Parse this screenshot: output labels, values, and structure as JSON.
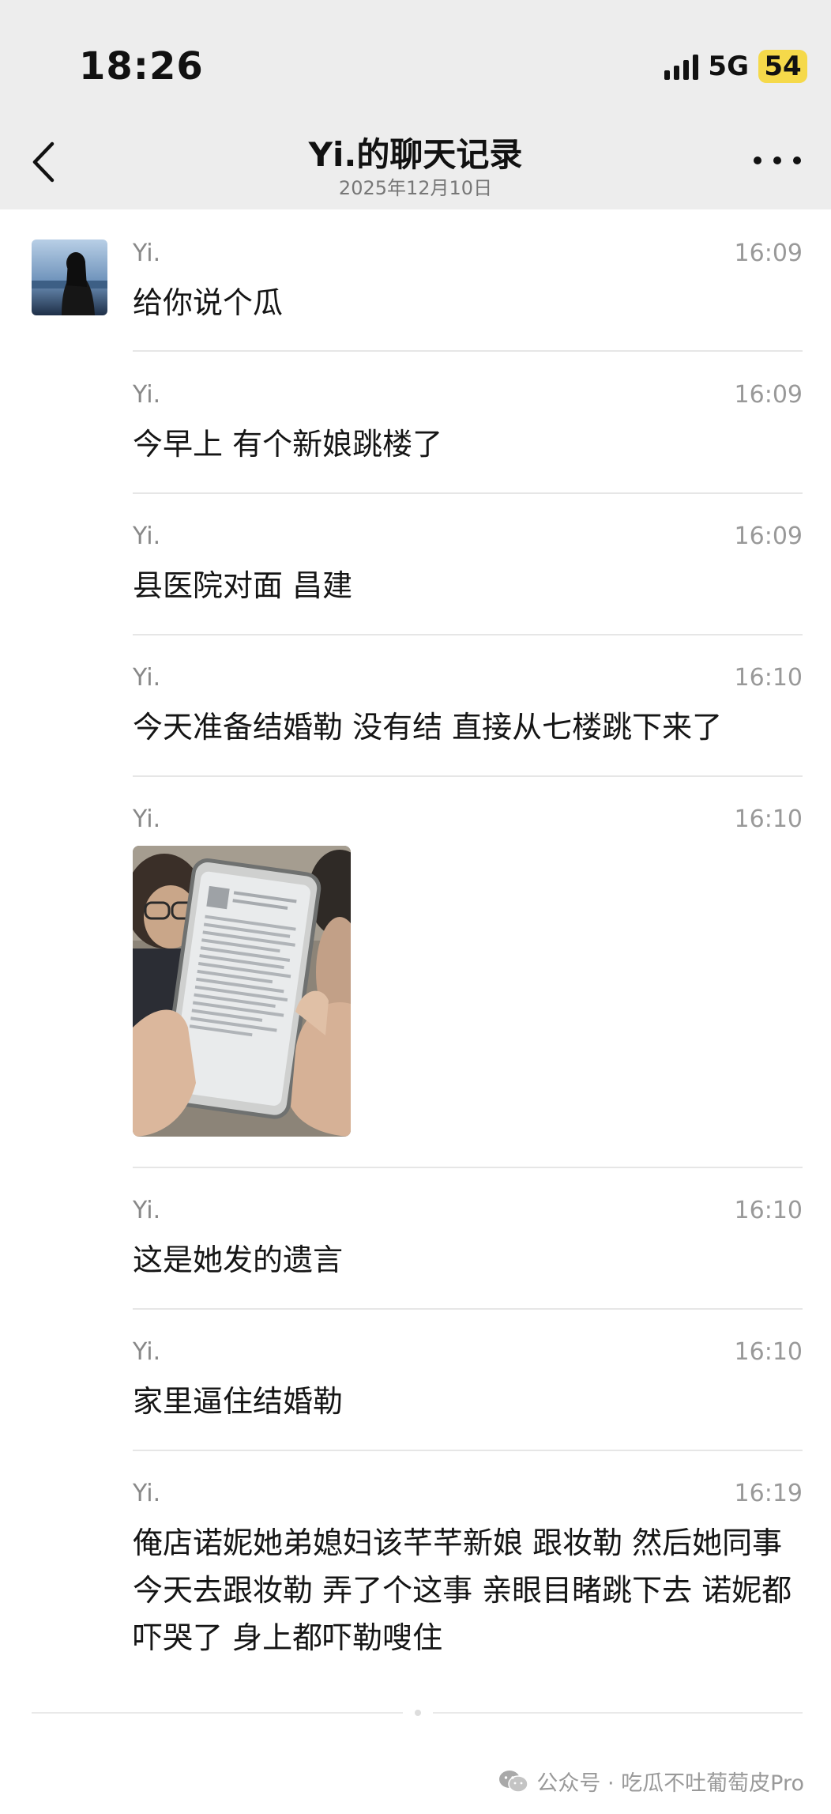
{
  "status_bar": {
    "time": "18:26",
    "network": "5G",
    "battery": "54"
  },
  "header": {
    "title": "Yi.的聊天记录",
    "subtitle": "2025年12月10日"
  },
  "messages": [
    {
      "sender": "Yi.",
      "time": "16:09",
      "text": "给你说个瓜"
    },
    {
      "sender": "Yi.",
      "time": "16:09",
      "text": "今早上 有个新娘跳楼了"
    },
    {
      "sender": "Yi.",
      "time": "16:09",
      "text": "县医院对面 昌建"
    },
    {
      "sender": "Yi.",
      "time": "16:10",
      "text": "今天准备结婚勒 没有结 直接从七楼跳下来了"
    },
    {
      "sender": "Yi.",
      "time": "16:10",
      "text": ""
    },
    {
      "sender": "Yi.",
      "time": "16:10",
      "text": "这是她发的遗言"
    },
    {
      "sender": "Yi.",
      "time": "16:10",
      "text": "家里逼住结婚勒"
    },
    {
      "sender": "Yi.",
      "time": "16:19",
      "text": "俺店诺妮她弟媳妇该芊芊新娘 跟妆勒 然后她同事今天去跟妆勒 弄了个这事 亲眼目睹跳下去 诺妮都吓哭了 身上都吓勒嗖住"
    }
  ],
  "watermark": {
    "text": "公众号 · 吃瓜不吐葡萄皮Pro"
  },
  "icons": {
    "back": "chevron-left-icon",
    "more": "more-dots-icon",
    "signal": "signal-bars-icon",
    "battery": "battery-icon",
    "wechat": "wechat-icon"
  },
  "colors": {
    "header_bg": "#ededed",
    "battery_fill": "#f5d94a",
    "divider": "#e6e6e6",
    "meta_text": "#888888"
  }
}
